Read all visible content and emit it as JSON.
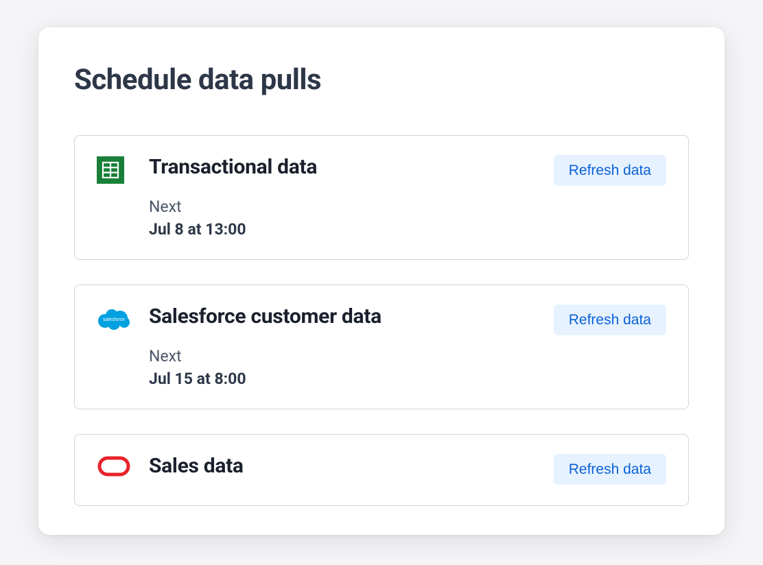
{
  "page": {
    "title": "Schedule data pulls"
  },
  "labels": {
    "next": "Next",
    "refresh": "Refresh data"
  },
  "pulls": [
    {
      "name": "Transactional data",
      "next_run": "Jul 8 at 13:00",
      "icon": "sheets"
    },
    {
      "name": "Salesforce customer data",
      "next_run": "Jul 15 at 8:00",
      "icon": "salesforce"
    },
    {
      "name": "Sales data",
      "next_run": "",
      "icon": "oracle"
    }
  ]
}
